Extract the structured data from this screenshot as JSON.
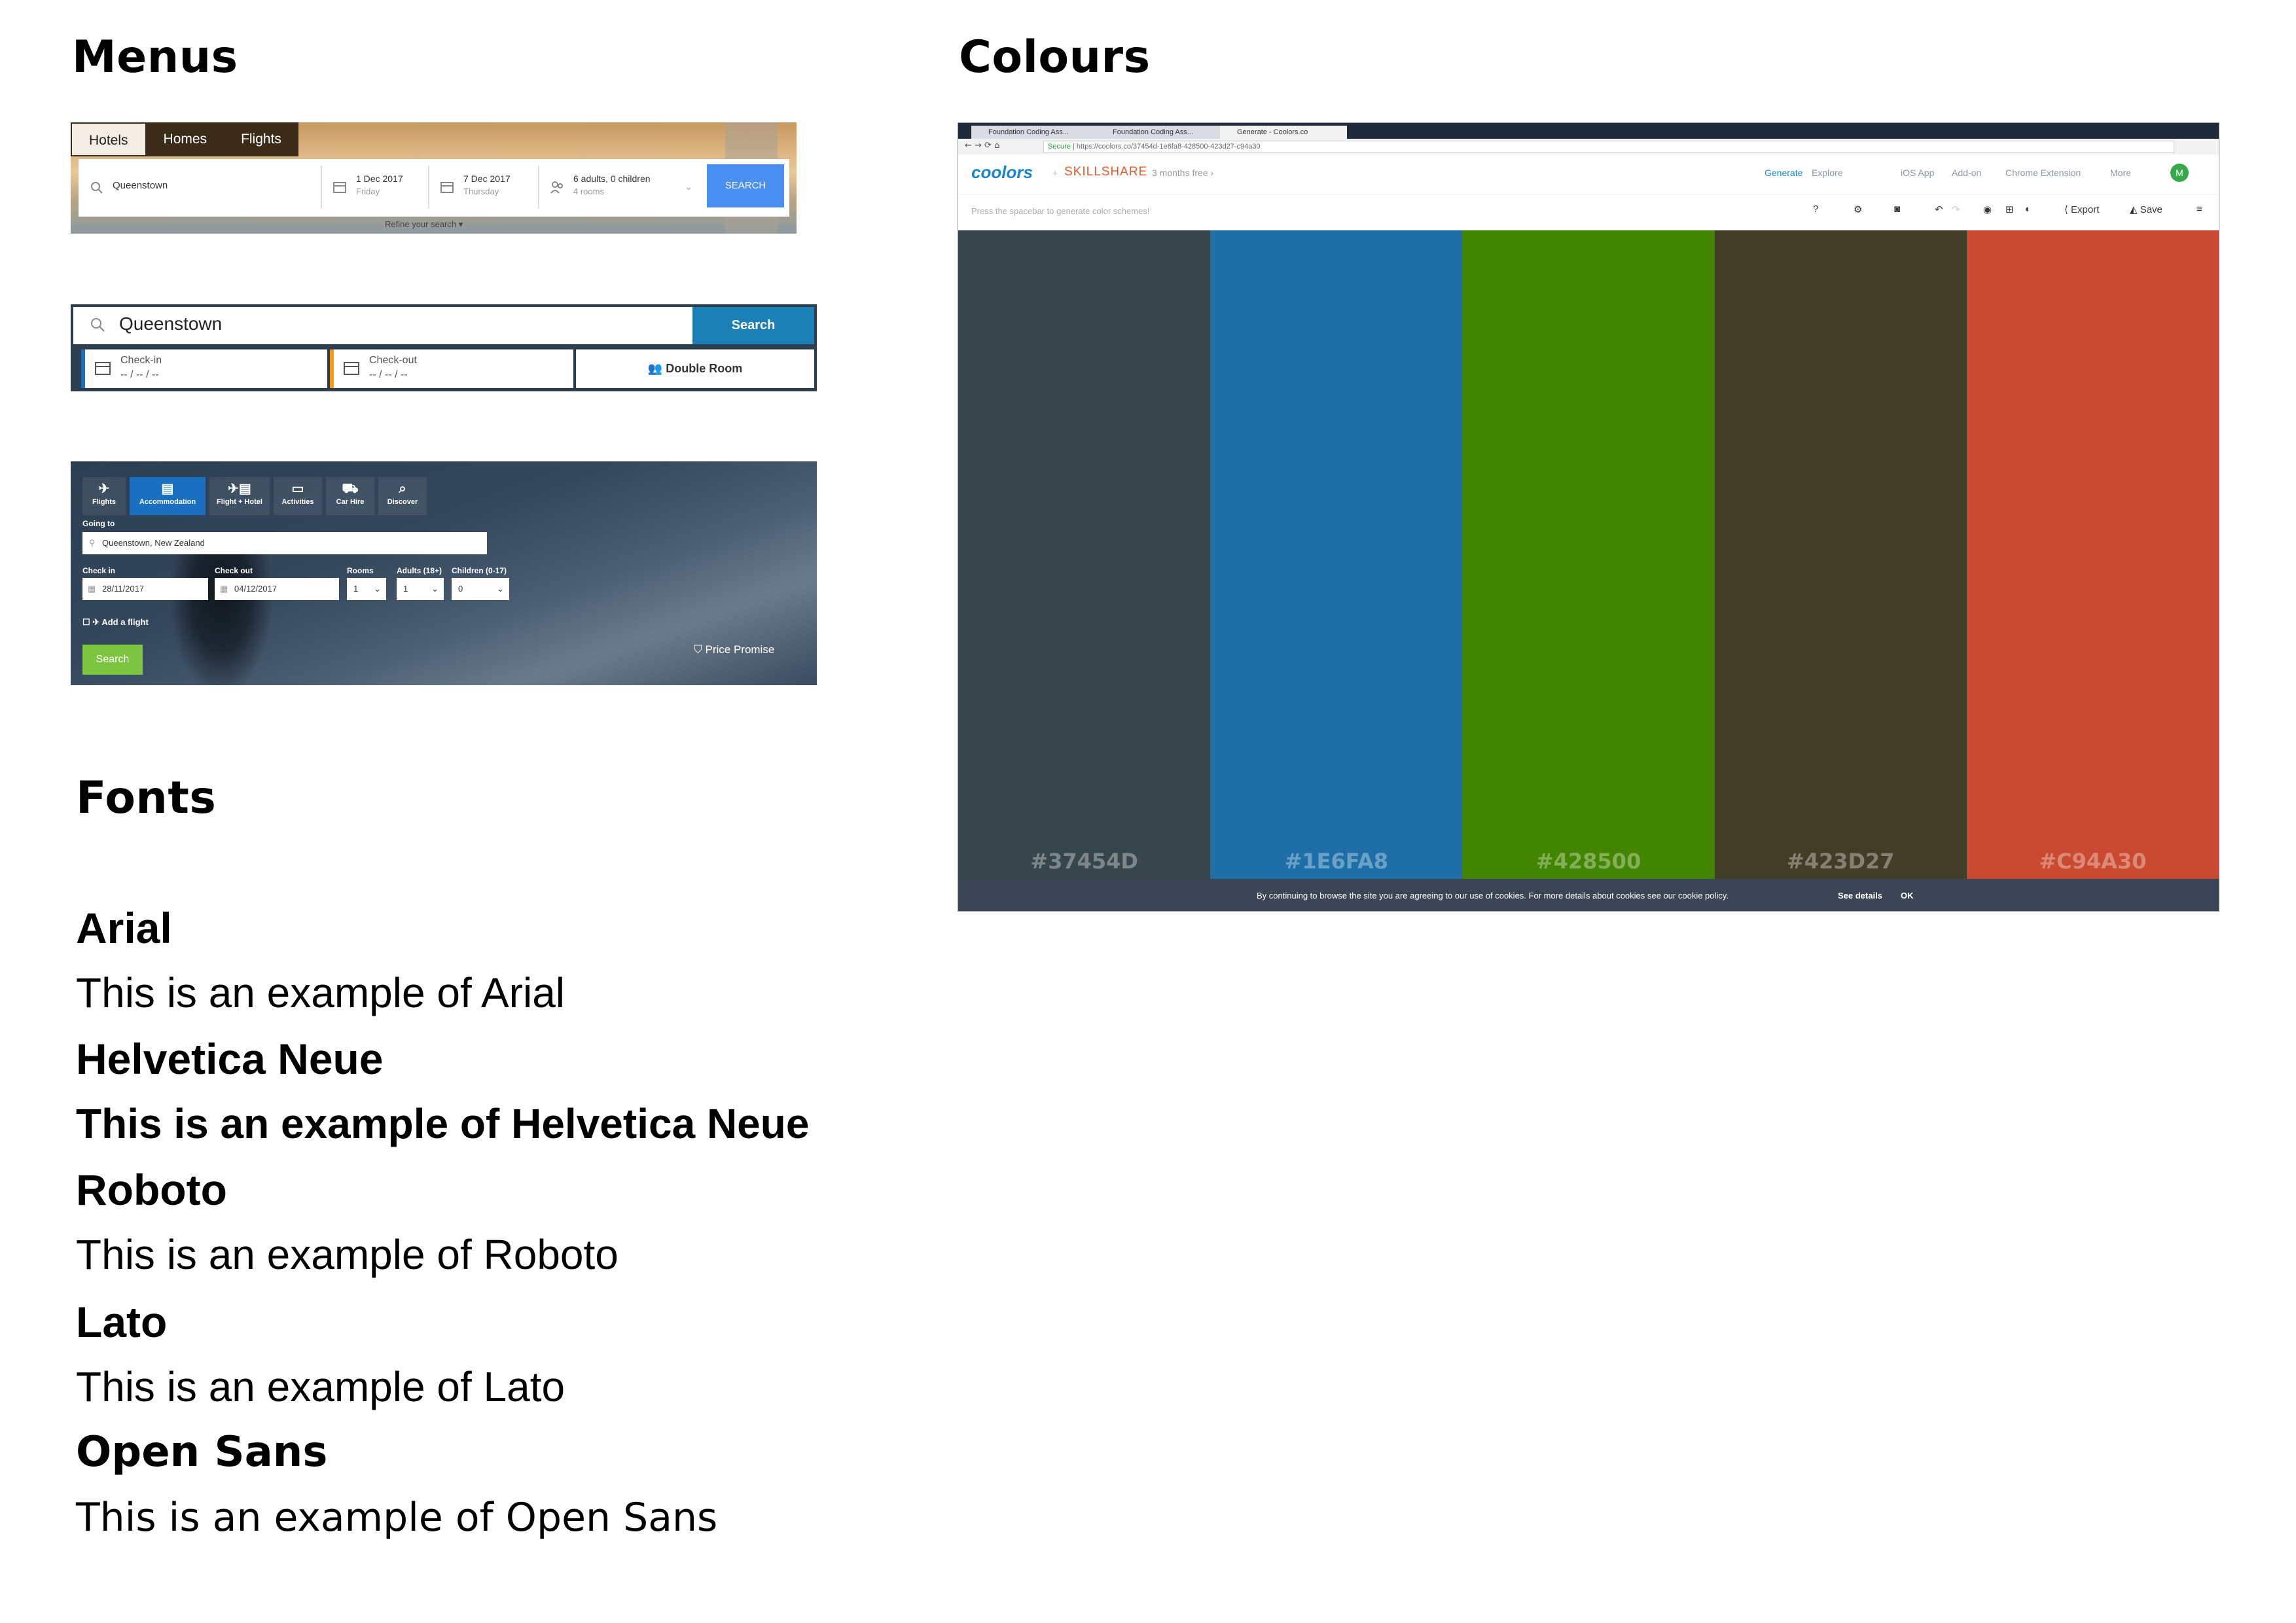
{
  "headings": {
    "menus": "Menus",
    "colours": "Colours",
    "fonts": "Fonts"
  },
  "menu1": {
    "tabs": [
      "Hotels",
      "Homes",
      "Flights"
    ],
    "search_value": "Queenstown",
    "checkin_date": "1 Dec 2017",
    "checkin_day": "Friday",
    "checkout_date": "7 Dec 2017",
    "checkout_day": "Thursday",
    "guests": "6 adults, 0 children",
    "rooms": "4 rooms",
    "search_label": "SEARCH",
    "refine_label": "Refine your search"
  },
  "menu2": {
    "search_value": "Queenstown",
    "search_label": "Search",
    "checkin_label": "Check-in",
    "checkin_value": "-- / -- / --",
    "checkout_label": "Check-out",
    "checkout_value": "-- / -- / --",
    "room_label": "Double Room"
  },
  "menu3": {
    "tabs": [
      {
        "label": "Flights",
        "icon": "plane-icon"
      },
      {
        "label": "Accommodation",
        "icon": "building-icon"
      },
      {
        "label": "Flight + Hotel",
        "icon": "plane-building-icon"
      },
      {
        "label": "Activities",
        "icon": "ticket-icon"
      },
      {
        "label": "Car Hire",
        "icon": "car-icon"
      },
      {
        "label": "Discover",
        "icon": "search-icon"
      }
    ],
    "going_to_label": "Going to",
    "going_to_value": "Queenstown, New Zealand",
    "checkin_label": "Check in",
    "checkin_value": "28/11/2017",
    "checkout_label": "Check out",
    "checkout_value": "04/12/2017",
    "rooms_label": "Rooms",
    "rooms_value": "1",
    "adults_label": "Adults (18+)",
    "adults_value": "1",
    "children_label": "Children (0-17)",
    "children_value": "0",
    "add_flight_label": "Add a flight",
    "search_label": "Search",
    "price_promise": "Price Promise"
  },
  "colours": {
    "browser_tabs": [
      "Foundation Coding Ass...",
      "Foundation Coding Ass...",
      "Generate - Coolors.co"
    ],
    "secure_label": "Secure",
    "url": "https://coolors.co/37454d-1e6fa8-428500-423d27-c94a30",
    "logo": "coolors",
    "partner": "SKILLSHARE",
    "promo": "3 months free",
    "nav": [
      "Generate",
      "Explore",
      "iOS App",
      "Add-on",
      "Chrome Extension",
      "More"
    ],
    "avatar_initial": "M",
    "hint": "Press the spacebar to generate color schemes!",
    "export_label": "Export",
    "save_label": "Save",
    "swatches": [
      {
        "hex": "#37454D",
        "color": "#37454D"
      },
      {
        "hex": "#1E6FA8",
        "color": "#1E6FA8"
      },
      {
        "hex": "#428500",
        "color": "#428500"
      },
      {
        "hex": "#423D27",
        "color": "#423D27"
      },
      {
        "hex": "#C94A30",
        "color": "#C94A30"
      }
    ],
    "cookie_text": "By continuing to browse the site you are agreeing to our use of cookies. For more details about cookies see our cookie policy.",
    "see_details": "See details",
    "ok_label": "OK"
  },
  "fonts": [
    {
      "name": "Arial",
      "sample": "This is an example of Arial"
    },
    {
      "name": "Helvetica Neue",
      "sample": "This is an example of Helvetica Neue"
    },
    {
      "name": "Roboto",
      "sample": "This is an example of Roboto"
    },
    {
      "name": "Lato",
      "sample": "This is an example of Lato"
    },
    {
      "name": "Open Sans",
      "sample": "This is an example of Open Sans"
    }
  ]
}
